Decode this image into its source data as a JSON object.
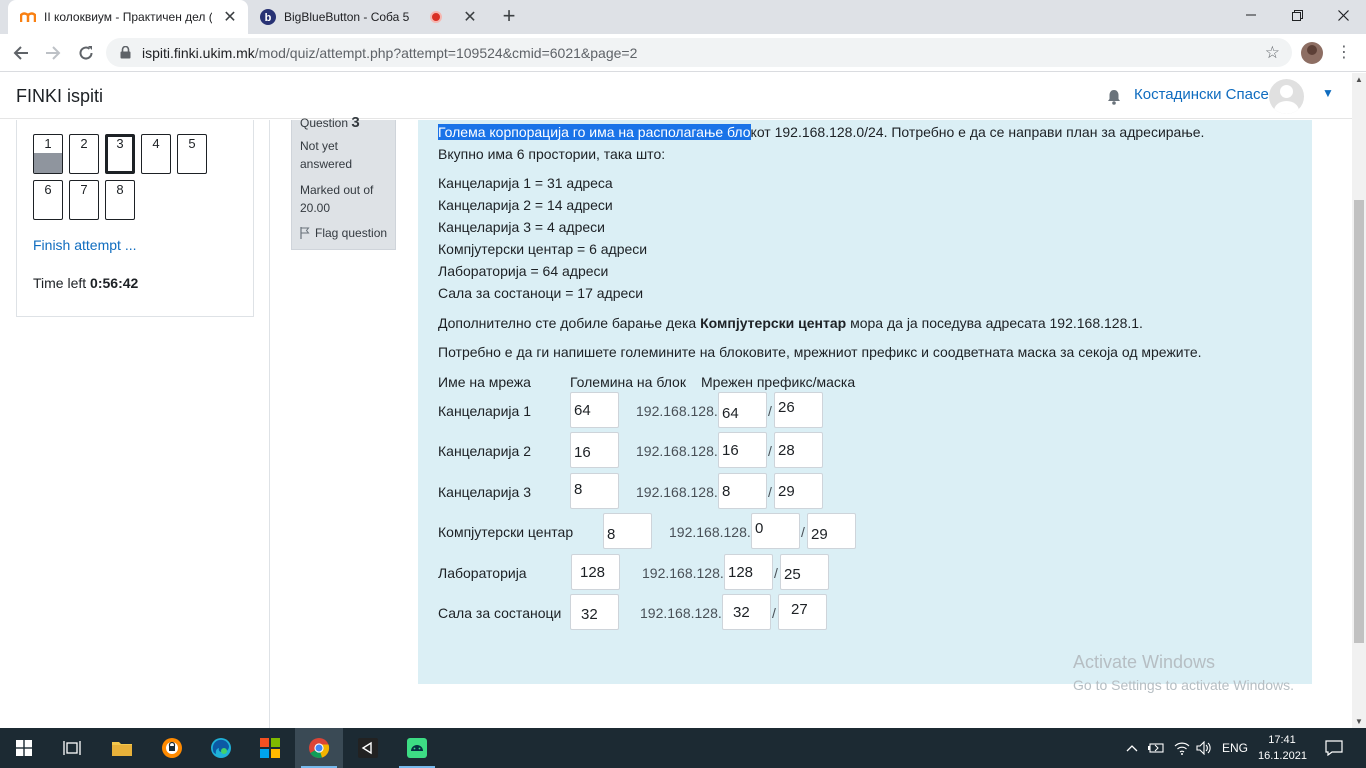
{
  "browser": {
    "tabs": [
      {
        "title": "II колоквиум - Практичен дел (р",
        "active": true
      },
      {
        "title": "BigBlueButton - Соба 5",
        "active": false
      }
    ],
    "new_tab": "+",
    "url_host": "ispiti.finki.ukim.mk",
    "url_path": "/mod/quiz/attempt.php?attempt=109524&cmid=6021&page=2"
  },
  "header": {
    "site_name": "FINKI ispiti",
    "user_name": "Костадински Спасе"
  },
  "quiz_nav": {
    "buttons": [
      {
        "label": "1",
        "state": "answered"
      },
      {
        "label": "2",
        "state": "notyet"
      },
      {
        "label": "3",
        "state": "current"
      },
      {
        "label": "4",
        "state": "notyet"
      },
      {
        "label": "5",
        "state": "notyet"
      },
      {
        "label": "6",
        "state": "notyet"
      },
      {
        "label": "7",
        "state": "notyet"
      },
      {
        "label": "8",
        "state": "notyet"
      }
    ],
    "finish_label": "Finish attempt ...",
    "time_left_label": "Time left",
    "time_left_value": "0:56:42"
  },
  "question_info": {
    "label": "Question",
    "number": "3",
    "state": "Not yet answered",
    "grade": "Marked out of 20.00",
    "flag_label": "Flag question"
  },
  "question": {
    "line1_selected": "Голема корпорација го има на располагање бло",
    "line1_rest": "кот 192.168.128.0/24. Потребно е да се направи план за адресирање.",
    "line2": "Вкупно има 6 простории, така што:",
    "requirements": [
      "Канцеларија 1 = 31 адреса",
      "Канцеларија 2 = 14 адреси",
      "Канцеларија 3 = 4 адреси",
      "Компјутерски центар = 6 адреси",
      "Лабораторија = 64 адреси",
      "Сала за состаноци = 17 адреси"
    ],
    "extra_before": "Дополнително сте добиле барање дека ",
    "extra_bold": "Компјутерски центар",
    "extra_after": " мора да ја поседува адресата 192.168.128.1.",
    "instruction": "Потребно е да ги напишете големините на блоковите, мрежниот префикс и соодветната маска за секоја од мрежите.",
    "col_name": "Име на мрежа",
    "col_size": "Големина на блок",
    "col_prefix": "Мрежен префикс/маска",
    "prefix_text": "192.168.128.",
    "slash": "/",
    "rows": [
      {
        "name": "Канцеларија 1",
        "size": "64",
        "prefix": "64",
        "mask": "26"
      },
      {
        "name": "Канцеларија 2",
        "size": "16",
        "prefix": "16",
        "mask": "28"
      },
      {
        "name": "Канцеларија 3",
        "size": "8",
        "prefix": "8",
        "mask": "29"
      },
      {
        "name": "Компјутерски центар",
        "size": "8",
        "prefix": "0",
        "mask": "29"
      },
      {
        "name": "Лабораторија",
        "size": "128",
        "prefix": "128",
        "mask": "25"
      },
      {
        "name": "Сала за состаноци",
        "size": "32",
        "prefix": "32",
        "mask": "27"
      }
    ]
  },
  "watermark": {
    "line1": "Activate Windows",
    "line2": "Go to Settings to activate Windows."
  },
  "taskbar": {
    "language": "ENG",
    "time": "17:41",
    "date": "16.1.2021"
  }
}
